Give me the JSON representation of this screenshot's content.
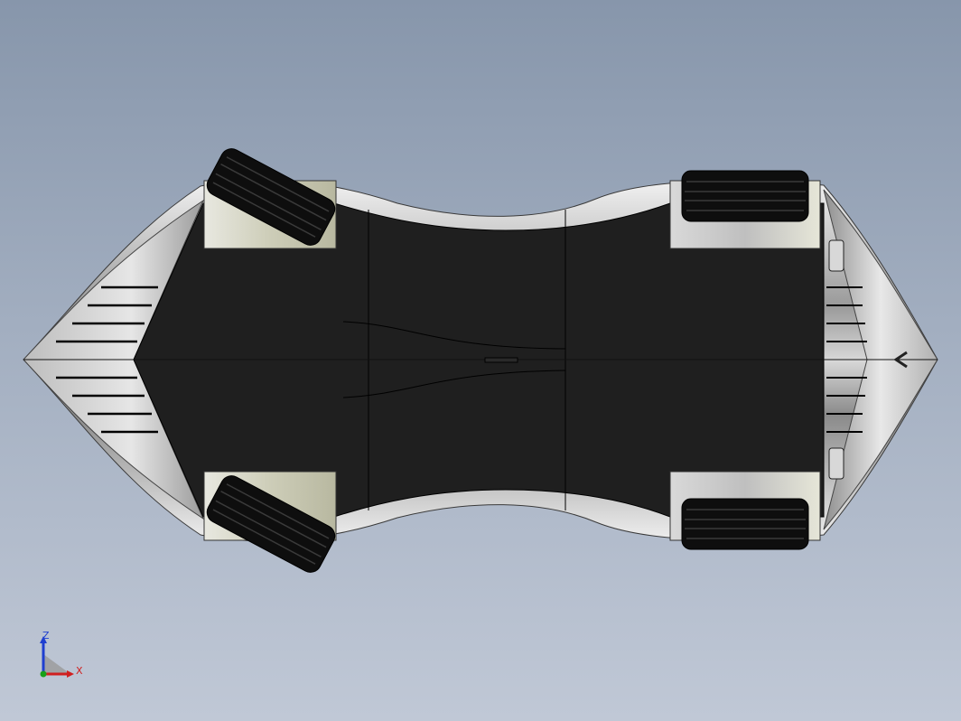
{
  "viewport": {
    "model": "car-underside-bottom-view",
    "background_top": "#8796ab",
    "background_bottom": "#c0c8d6",
    "body_color": "#1f1f1f",
    "shell_color": "#c8c8c8",
    "tire_color": "#0e0e0e"
  },
  "triad": {
    "z_label": "Z",
    "x_label": "X",
    "z_color": "#1f3fd0",
    "x_color": "#d01f1f",
    "origin_color": "#18a018"
  }
}
